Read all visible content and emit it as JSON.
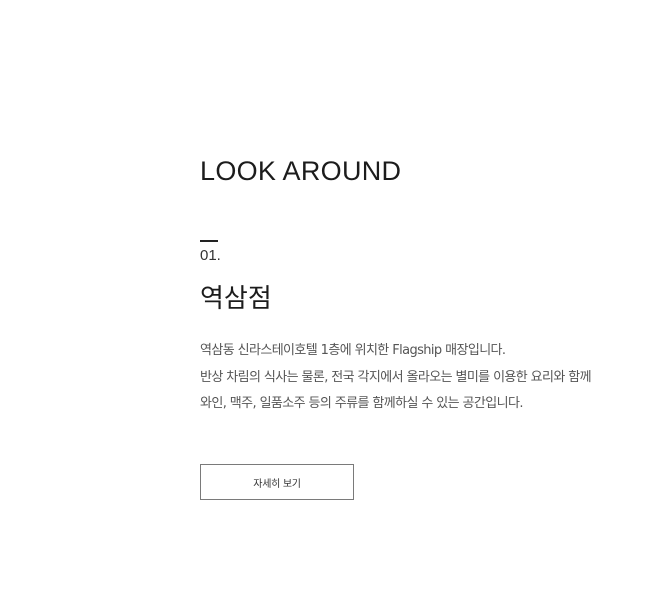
{
  "section": {
    "title": "LOOK AROUND"
  },
  "store": {
    "index": "01.",
    "name": "역삼점",
    "description": [
      "역삼동 신라스테이호텔 1층에 위치한 Flagship 매장입니다.",
      "반상 차림의 식사는 물론, 전국 각지에서 올라오는 별미를 이용한 요리와 함께",
      "와인, 맥주, 일품소주 등의 주류를 함께하실 수 있는 공간입니다."
    ],
    "detail_button_label": "자세히 보기"
  }
}
